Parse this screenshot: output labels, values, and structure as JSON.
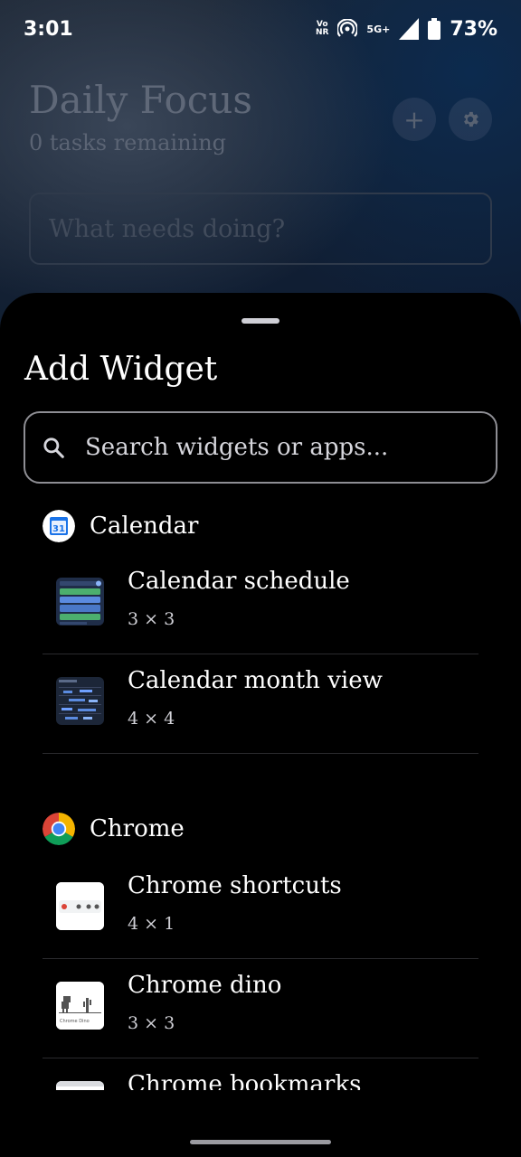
{
  "status_bar": {
    "time": "3:01",
    "vonr": [
      "Vo",
      "NR"
    ],
    "network": "5G+",
    "battery": "73%"
  },
  "background_app": {
    "title": "Daily Focus",
    "subtitle": "0 tasks remaining",
    "input_placeholder": "What needs doing?",
    "add_icon": "plus-icon",
    "settings_icon": "gear-icon"
  },
  "sheet": {
    "title": "Add Widget",
    "search_placeholder": "Search widgets or apps...",
    "groups": [
      {
        "app": "Calendar",
        "icon_text": "31",
        "widgets": [
          {
            "name": "Calendar schedule",
            "size": "3 × 3"
          },
          {
            "name": "Calendar month view",
            "size": "4 × 4"
          }
        ]
      },
      {
        "app": "Chrome",
        "widgets": [
          {
            "name": "Chrome shortcuts",
            "size": "4 × 1"
          },
          {
            "name": "Chrome dino",
            "size": "3 × 3",
            "thumb_caption": "Chrome Dino"
          },
          {
            "name": "Chrome bookmarks",
            "size": ""
          }
        ]
      }
    ]
  },
  "colors": {
    "sheet_bg": "#000000",
    "chrome_red": "#db4437",
    "chrome_green": "#0f9d58",
    "chrome_yellow": "#f4b400",
    "chrome_blue": "#4285f4",
    "calendar_blue": "#1a73e8"
  }
}
